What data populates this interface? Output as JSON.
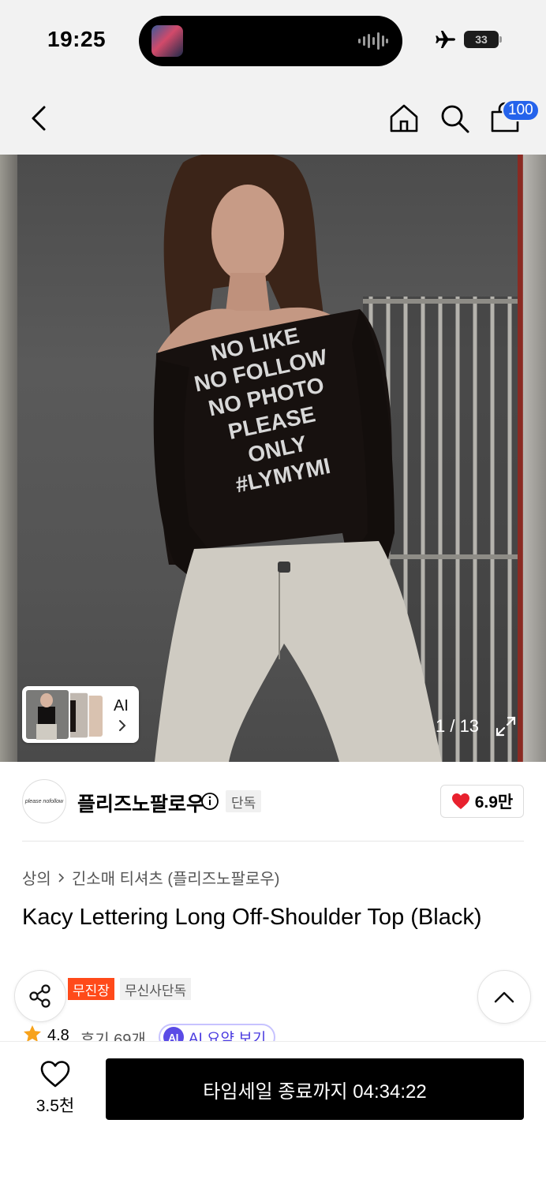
{
  "status_bar": {
    "time": "19:25",
    "battery": "33",
    "icons": [
      "airplane-icon",
      "battery-icon",
      "audio-wave-icon"
    ]
  },
  "nav": {
    "cart_count": "100",
    "icons": [
      "back-icon",
      "home-icon",
      "search-icon",
      "cart-icon"
    ]
  },
  "hero": {
    "shirt_print": [
      "NO LIKE",
      "NO FOLLOW",
      "NO PHOTO",
      "PLEASE",
      "ONLY",
      "#LYMYMI"
    ],
    "ai_label": "AI",
    "counter": "1 / 13"
  },
  "brand": {
    "logo_text": "please nofollow",
    "name": "플리즈노팔로우",
    "exclusive_tag": "단독",
    "likes": "6.9만"
  },
  "product": {
    "breadcrumb": [
      "상의",
      "긴소매 티셔츠 (플리즈노팔로우)"
    ],
    "title": "Kacy Lettering Long Off-Shoulder Top (Black)",
    "tags": [
      "무진장",
      "무신사단독"
    ],
    "rating": "4.8",
    "reviews": "후기 69개",
    "ai_summary_badge": "AI",
    "ai_summary": "AI 요약 보기"
  },
  "bottom": {
    "wish_count": "3.5천",
    "buy_label": "타임세일 종료까지 04:34:22"
  },
  "colors": {
    "accent_blue": "#2563eb",
    "heart_red": "#e8212e",
    "tag_orange": "#ff4a1a",
    "ai_purple": "#5a4be6"
  }
}
